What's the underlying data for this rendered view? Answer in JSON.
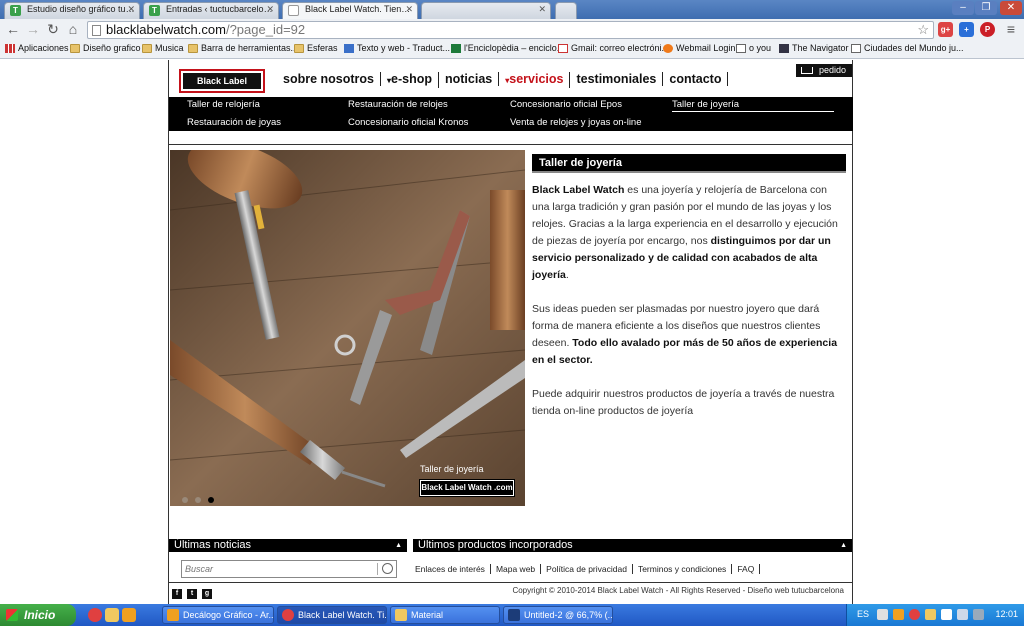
{
  "browser": {
    "tabs": [
      {
        "title": "Estudio diseño gráfico tuc tuc",
        "favicon": "T",
        "color": "#3aa04a",
        "active": false
      },
      {
        "title": "Entradas ‹ tuctucbarcelona —",
        "favicon": "T",
        "color": "#3aa04a",
        "active": false
      },
      {
        "title": "Black Label Watch. Tienda c",
        "favicon": "",
        "color": "#cccccc",
        "active": true
      },
      {
        "title": "",
        "favicon": "",
        "color": "#cccccc",
        "active": false
      }
    ],
    "url_host": "blacklabelwatch.com",
    "url_path": "/?page_id=92",
    "bookmarks": [
      {
        "label": "Aplicaciones",
        "icon": "apps-icon"
      },
      {
        "label": "Diseño grafico",
        "icon": "folder-icon"
      },
      {
        "label": "Musica",
        "icon": "folder-icon"
      },
      {
        "label": "Barra de herramientas...",
        "icon": "folder-icon"
      },
      {
        "label": "Esferas",
        "icon": "folder-icon"
      },
      {
        "label": "Texto y web - Traduct...",
        "icon": "translate-icon"
      },
      {
        "label": "l'Enciclopèdia – enciclo...",
        "icon": "encyclopedia-icon"
      },
      {
        "label": "Gmail: correo electróni...",
        "icon": "gmail-icon"
      },
      {
        "label": "Webmail Login",
        "icon": "cpanel-icon"
      },
      {
        "label": "o you",
        "icon": "page-icon"
      },
      {
        "label": "The Navigator",
        "icon": "navigator-icon"
      },
      {
        "label": "Ciudades del Mundo ju...",
        "icon": "page-icon"
      }
    ]
  },
  "site": {
    "logo_text": "Black Label Watch",
    "main_nav": [
      {
        "label": "sobre nosotros",
        "caret": false,
        "active": false
      },
      {
        "label": "e-shop",
        "caret": true,
        "active": false
      },
      {
        "label": "noticias",
        "caret": false,
        "active": false
      },
      {
        "label": "servicios",
        "caret": true,
        "active": true
      },
      {
        "label": "testimoniales",
        "caret": false,
        "active": false
      },
      {
        "label": "contacto",
        "caret": false,
        "active": false
      }
    ],
    "pedido_label": "pedido",
    "sub_nav": {
      "taller_relojeria": "Taller de relojería",
      "restauracion_relojes": "Restauración de relojes",
      "concesionario_epos": "Concesionario oficial Epos",
      "taller_joyeria": "Taller de joyería",
      "restauracion_joyas": "Restauración de joyas",
      "concesionario_kronos": "Concesionario oficial Kronos",
      "venta_online": "Venta de relojes y joyas on-line"
    },
    "hero": {
      "caption": "Taller de joyería",
      "brand": "Black Label Watch .com",
      "dots_total": 3,
      "dot_active_index": 2
    },
    "content": {
      "title": "Taller de joyería",
      "p1_brand": "Black Label Watch",
      "p1_text": " es una joyería y relojería de Barcelona con una larga tradición y gran pasión por el mundo de las joyas y los relojes. Gracias a la larga experiencia en el desarrollo y ejecución de piezas de joyería por encargo, nos ",
      "p1_bold": "distinguimos por dar un servicio personalizado y de calidad con acabados de alta joyería",
      "p1_end": ".",
      "p2_text": "Sus ideas pueden ser plasmadas por nuestro joyero que dará forma de manera eficiente a los diseños que nuestros clientes deseen. ",
      "p2_bold": "Todo ello avalado por más de 50 años de experiencia en el sector.",
      "p3_text": "Puede adquirir nuestros productos de joyería a través de nuestra tienda on-line productos de joyería"
    },
    "footer": {
      "news_bar": "Últimas noticias",
      "products_bar": "Últimos productos incorporados",
      "search_placeholder": "Buscar",
      "links": [
        "Enlaces de interés",
        "Mapa web",
        "Política de privacidad",
        "Terminos y condiciones",
        "FAQ"
      ],
      "copyright": "Copyright © 2010-2014 Black Label Watch - All Rights Reserved - Diseño web tutucbarcelona"
    }
  },
  "taskbar": {
    "start_label": "Inicio",
    "tasks": [
      {
        "label": "Decálogo Gráfico - Ar...",
        "color": "#f0a020",
        "active": false
      },
      {
        "label": "Black Label Watch. Ti...",
        "color": "#e04040",
        "active": true
      },
      {
        "label": "Material",
        "color": "#f0c860",
        "active": false
      },
      {
        "label": "Untitled-2 @ 66,7% (...",
        "color": "#1c3c78",
        "active": false
      }
    ],
    "language": "ES",
    "clock": "12:01"
  }
}
